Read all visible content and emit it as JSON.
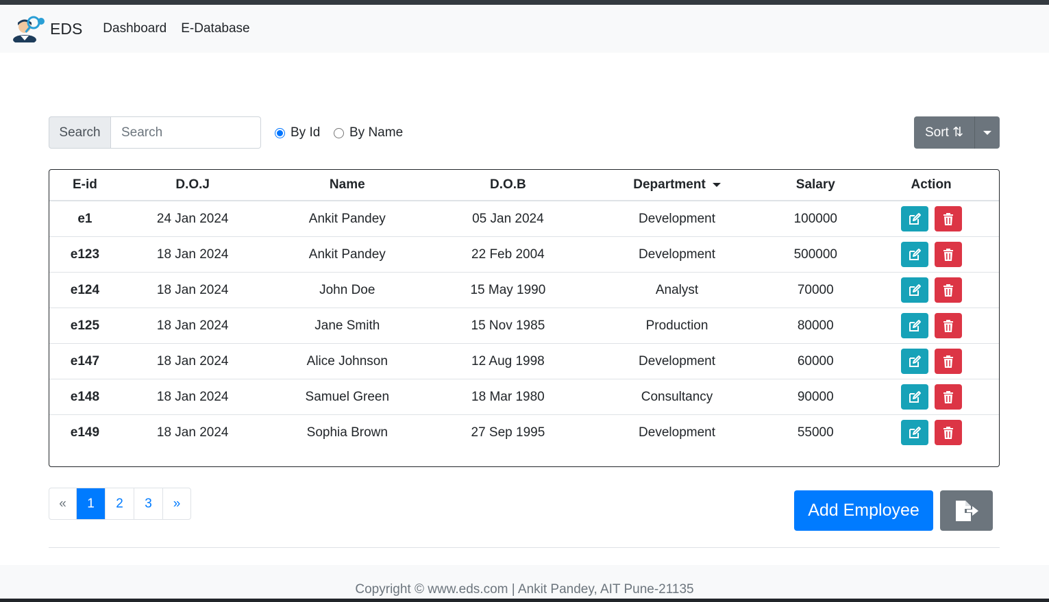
{
  "navbar": {
    "brand": "EDS",
    "links": [
      "Dashboard",
      "E-Database"
    ]
  },
  "search": {
    "addon_label": "Search",
    "placeholder": "Search",
    "value": ""
  },
  "filter": {
    "options": [
      "By Id",
      "By Name"
    ],
    "selected": "By Id"
  },
  "sort": {
    "label": "Sort ⇅"
  },
  "table": {
    "headers": [
      "E-id",
      "D.O.J",
      "Name",
      "D.O.B",
      "Department",
      "Salary",
      "Action"
    ],
    "rows": [
      {
        "eid": "e1",
        "doj": "24 Jan 2024",
        "name": "Ankit Pandey",
        "dob": "05 Jan 2024",
        "department": "Development",
        "salary": "100000"
      },
      {
        "eid": "e123",
        "doj": "18 Jan 2024",
        "name": "Ankit Pandey",
        "dob": "22 Feb 2004",
        "department": "Development",
        "salary": "500000"
      },
      {
        "eid": "e124",
        "doj": "18 Jan 2024",
        "name": "John Doe",
        "dob": "15 May 1990",
        "department": "Analyst",
        "salary": "70000"
      },
      {
        "eid": "e125",
        "doj": "18 Jan 2024",
        "name": "Jane Smith",
        "dob": "15 Nov 1985",
        "department": "Production",
        "salary": "80000"
      },
      {
        "eid": "e147",
        "doj": "18 Jan 2024",
        "name": "Alice Johnson",
        "dob": "12 Aug 1998",
        "department": "Development",
        "salary": "60000"
      },
      {
        "eid": "e148",
        "doj": "18 Jan 2024",
        "name": "Samuel Green",
        "dob": "18 Mar 1980",
        "department": "Consultancy",
        "salary": "90000"
      },
      {
        "eid": "e149",
        "doj": "18 Jan 2024",
        "name": "Sophia Brown",
        "dob": "27 Sep 1995",
        "department": "Development",
        "salary": "55000"
      }
    ]
  },
  "pagination": {
    "prev": "«",
    "pages": [
      "1",
      "2",
      "3"
    ],
    "active": "1",
    "next": "»"
  },
  "actions": {
    "add_employee": "Add Employee"
  },
  "footer": {
    "text": "Copyright © www.eds.com | Ankit Pandey, AIT Pune-21135"
  },
  "colors": {
    "primary": "#007bff",
    "info": "#17a2b8",
    "danger": "#dc3545",
    "secondary": "#6c757d"
  }
}
